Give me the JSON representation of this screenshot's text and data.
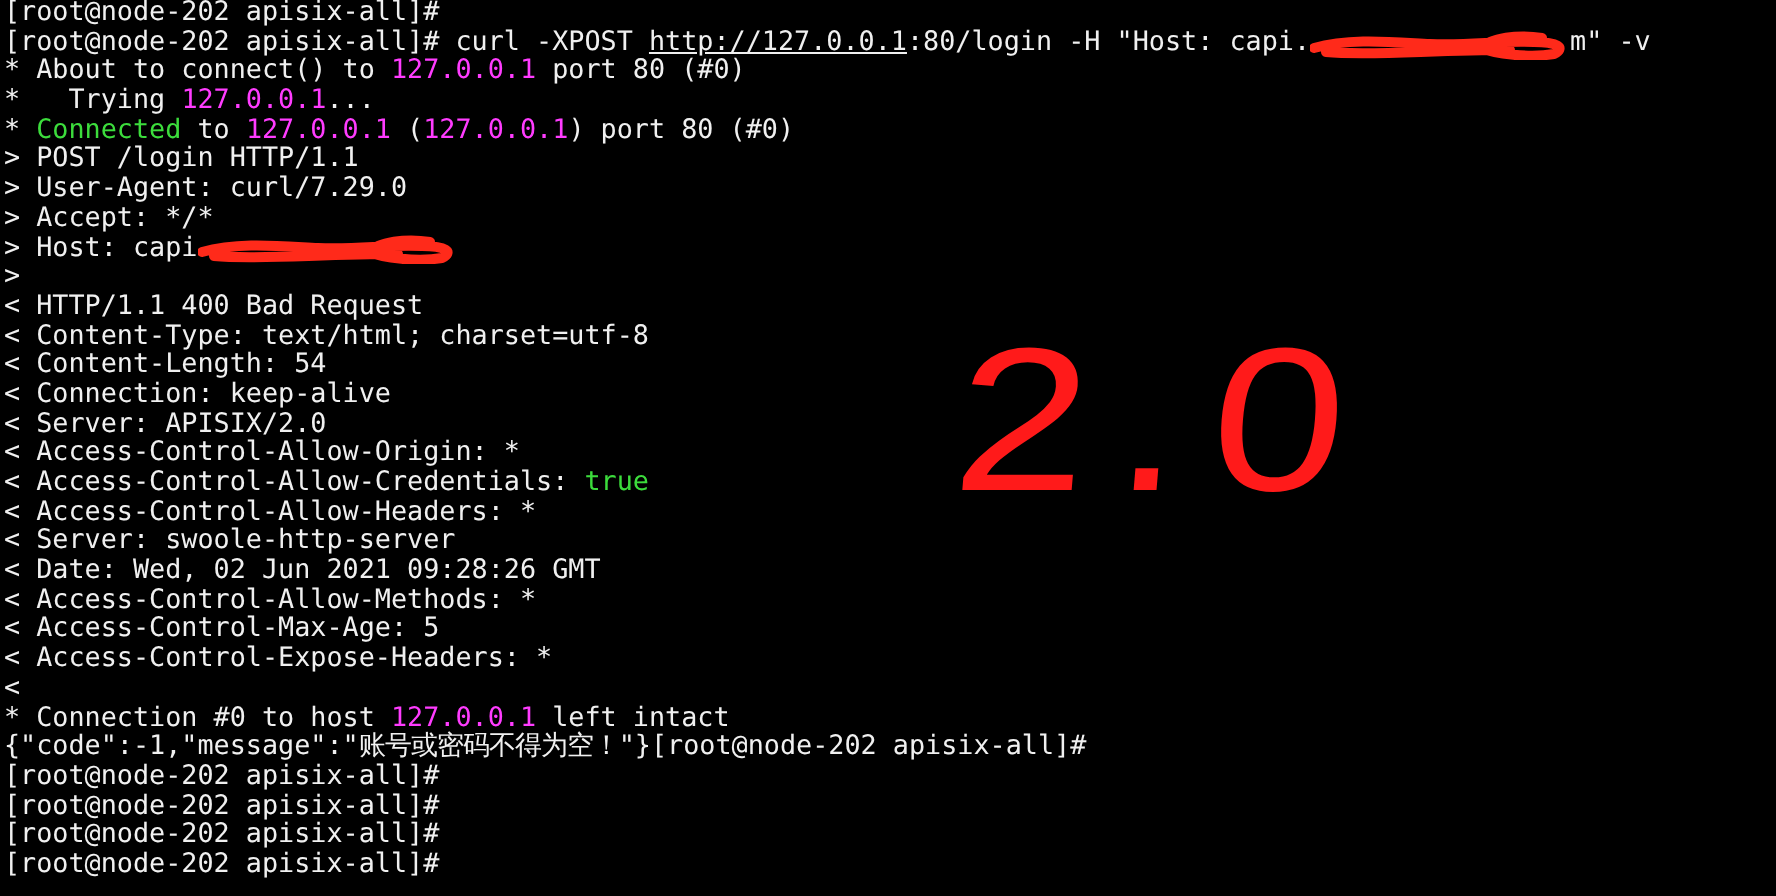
{
  "terminal": {
    "lines": [
      {
        "segments": [
          {
            "kind": "plain",
            "text": "[root@node-202 apisix-all]#"
          }
        ]
      },
      {
        "segments": [
          {
            "kind": "plain",
            "text": "[root@node-202 apisix-all]# curl -XPOST "
          },
          {
            "kind": "link",
            "text": "http://127.0.0.1"
          },
          {
            "kind": "plain",
            "text": ":80/login -H \"Host: capi."
          },
          {
            "kind": "redaction"
          },
          {
            "kind": "plain",
            "text": "m\" -v"
          }
        ]
      },
      {
        "segments": [
          {
            "kind": "plain",
            "text": "* About to connect() to "
          },
          {
            "kind": "ip",
            "text": "127.0.0.1"
          },
          {
            "kind": "plain",
            "text": " port 80 (#0)"
          }
        ]
      },
      {
        "segments": [
          {
            "kind": "plain",
            "text": "*   Trying "
          },
          {
            "kind": "ip",
            "text": "127.0.0.1"
          },
          {
            "kind": "plain",
            "text": "..."
          }
        ]
      },
      {
        "segments": [
          {
            "kind": "plain",
            "text": "* "
          },
          {
            "kind": "ok",
            "text": "Connected"
          },
          {
            "kind": "plain",
            "text": " to "
          },
          {
            "kind": "ip",
            "text": "127.0.0.1"
          },
          {
            "kind": "plain",
            "text": " ("
          },
          {
            "kind": "ip",
            "text": "127.0.0.1"
          },
          {
            "kind": "plain",
            "text": ") port 80 (#0)"
          }
        ]
      },
      {
        "segments": [
          {
            "kind": "plain",
            "text": "> POST /login HTTP/1.1"
          }
        ]
      },
      {
        "segments": [
          {
            "kind": "plain",
            "text": "> User-Agent: curl/7.29.0"
          }
        ]
      },
      {
        "segments": [
          {
            "kind": "plain",
            "text": "> Accept: */*"
          }
        ]
      },
      {
        "segments": [
          {
            "kind": "plain",
            "text": "> Host: capi"
          },
          {
            "kind": "redaction"
          }
        ]
      },
      {
        "segments": [
          {
            "kind": "plain",
            "text": ">"
          }
        ]
      },
      {
        "segments": [
          {
            "kind": "plain",
            "text": "< HTTP/1.1 400 Bad Request"
          }
        ]
      },
      {
        "segments": [
          {
            "kind": "plain",
            "text": "< Content-Type: text/html; charset=utf-8"
          }
        ]
      },
      {
        "segments": [
          {
            "kind": "plain",
            "text": "< Content-Length: 54"
          }
        ]
      },
      {
        "segments": [
          {
            "kind": "plain",
            "text": "< Connection: keep-alive"
          }
        ]
      },
      {
        "segments": [
          {
            "kind": "plain",
            "text": "< Server: APISIX/2.0"
          }
        ]
      },
      {
        "segments": [
          {
            "kind": "plain",
            "text": "< Access-Control-Allow-Origin: *"
          }
        ]
      },
      {
        "segments": [
          {
            "kind": "plain",
            "text": "< Access-Control-Allow-Credentials: "
          },
          {
            "kind": "ok",
            "text": "true"
          }
        ]
      },
      {
        "segments": [
          {
            "kind": "plain",
            "text": "< Access-Control-Allow-Headers: *"
          }
        ]
      },
      {
        "segments": [
          {
            "kind": "plain",
            "text": "< Server: swoole-http-server"
          }
        ]
      },
      {
        "segments": [
          {
            "kind": "plain",
            "text": "< Date: Wed, 02 Jun 2021 09:28:26 GMT"
          }
        ]
      },
      {
        "segments": [
          {
            "kind": "plain",
            "text": "< Access-Control-Allow-Methods: *"
          }
        ]
      },
      {
        "segments": [
          {
            "kind": "plain",
            "text": "< Access-Control-Max-Age: 5"
          }
        ]
      },
      {
        "segments": [
          {
            "kind": "plain",
            "text": "< Access-Control-Expose-Headers: *"
          }
        ]
      },
      {
        "segments": [
          {
            "kind": "plain",
            "text": "<"
          }
        ]
      },
      {
        "segments": [
          {
            "kind": "plain",
            "text": "* Connection #0 to host "
          },
          {
            "kind": "ip",
            "text": "127.0.0.1"
          },
          {
            "kind": "plain",
            "text": " left intact"
          }
        ]
      },
      {
        "segments": [
          {
            "kind": "plain",
            "text": "{\"code\":-1,\"message\":\"账号或密码不得为空！\"}[root@node-202 apisix-all]#"
          }
        ]
      },
      {
        "segments": [
          {
            "kind": "plain",
            "text": "[root@node-202 apisix-all]#"
          }
        ]
      },
      {
        "segments": [
          {
            "kind": "plain",
            "text": "[root@node-202 apisix-all]#"
          }
        ]
      },
      {
        "segments": [
          {
            "kind": "plain",
            "text": "[root@node-202 apisix-all]#"
          }
        ]
      },
      {
        "segments": [
          {
            "kind": "plain",
            "text": "[root@node-202 apisix-all]#"
          }
        ]
      }
    ]
  },
  "annotation": {
    "text": "2.0"
  }
}
